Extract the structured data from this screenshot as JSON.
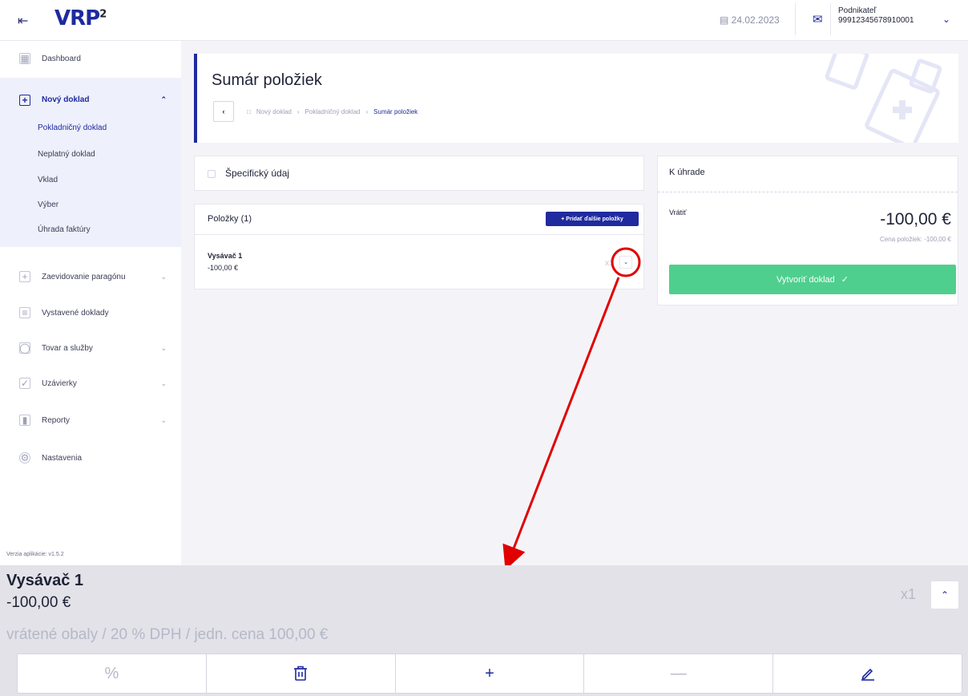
{
  "topbar": {
    "collapse_icon": "collapse-sidebar-icon",
    "logo_text": "VRP",
    "logo_sup": "2",
    "date": "24.02.2023",
    "user_role": "Podnikateľ",
    "user_id": "99912345678910001"
  },
  "sidebar": {
    "items": [
      {
        "label": "Dashboard"
      },
      {
        "label": "Nový doklad"
      },
      {
        "label": "Zaevidovanie paragónu"
      },
      {
        "label": "Vystavené doklady"
      },
      {
        "label": "Tovar a služby"
      },
      {
        "label": "Uzávierky"
      },
      {
        "label": "Reporty"
      },
      {
        "label": "Nastavenia"
      }
    ],
    "subitems": [
      {
        "label": "Pokladničný doklad"
      },
      {
        "label": "Neplatný doklad"
      },
      {
        "label": "Vklad"
      },
      {
        "label": "Výber"
      },
      {
        "label": "Úhrada faktúry"
      }
    ],
    "version": "Verzia aplikácie: v1.5.2"
  },
  "header": {
    "title": "Sumár položiek",
    "breadcrumb": [
      "Nový doklad",
      "Pokladničný doklad",
      "Sumár položiek"
    ]
  },
  "specific": {
    "label": "Špecifický údaj"
  },
  "items_card": {
    "title": "Položky (1)",
    "add_button": "+ Pridať ďalšie položky",
    "item": {
      "name": "Vysávač 1",
      "price": "-100,00 €",
      "qty": "x1"
    }
  },
  "payment": {
    "title": "K úhrade",
    "return_label": "Vrátiť",
    "amount": "-100,00 €",
    "items_price": "Cena položiek: -100,00 €",
    "create_button": "Vytvoriť doklad"
  },
  "detail": {
    "name": "Vysávač 1",
    "price": "-100,00 €",
    "description": "vrátené obaly / 20 % DPH / jedn. cena 100,00 €",
    "qty": "x1"
  },
  "colors": {
    "accent": "#1f2a9e",
    "success": "#4fcf8d",
    "annotation": "#e00000"
  }
}
